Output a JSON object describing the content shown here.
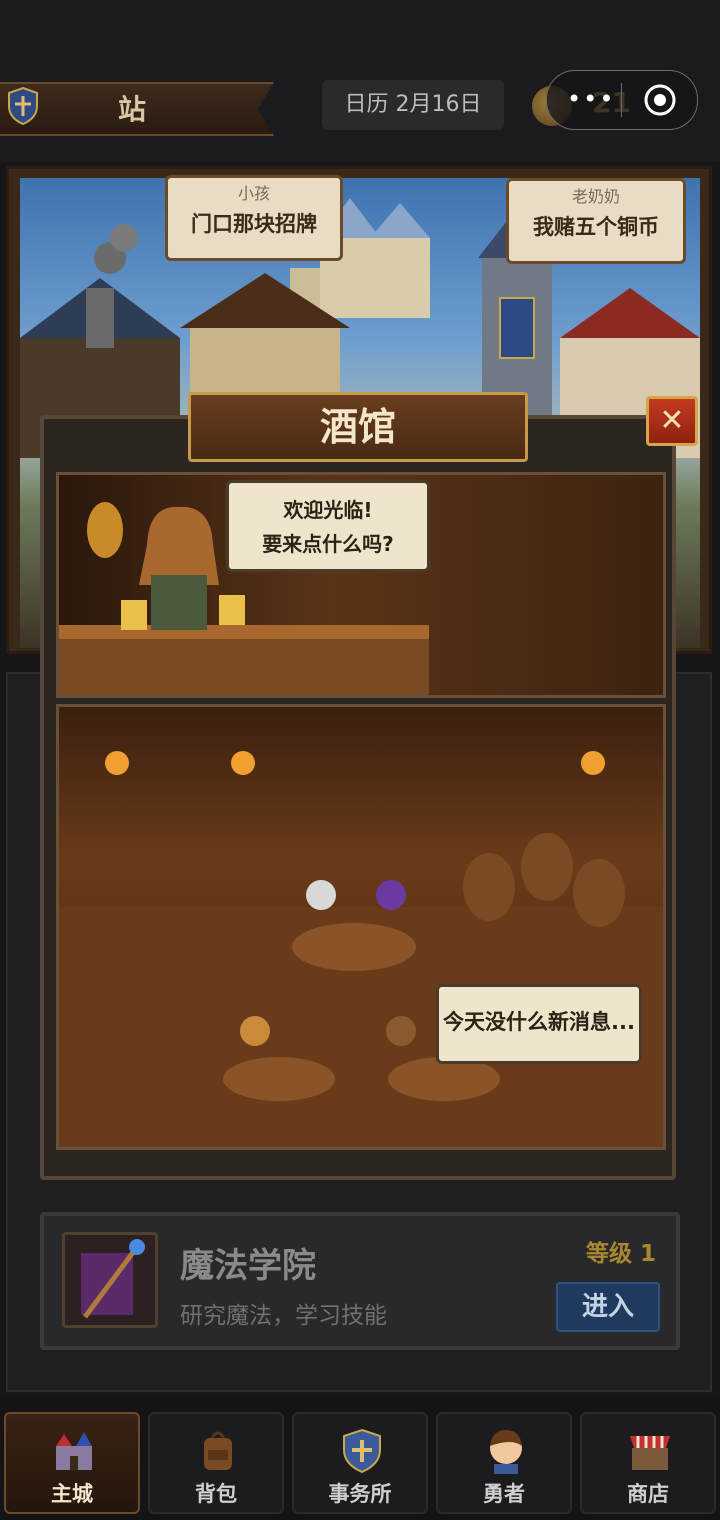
{
  "header": {
    "location": "站",
    "calendar": "日历 2月16日",
    "coins": "21"
  },
  "miniprogram_capsule": {
    "more": "•••"
  },
  "town": {
    "bubbles": [
      {
        "speaker": "小孩",
        "text": "门口那块招牌"
      },
      {
        "speaker": "老奶奶",
        "text": "我赌五个铜币"
      }
    ]
  },
  "tavern": {
    "title": "酒馆",
    "close_glyph": "✕",
    "barmaid_line1": "欢迎光临!",
    "barmaid_line2": "要来点什么吗?",
    "patron_speech": "今天没什么新消息..."
  },
  "academy": {
    "name": "魔法学院",
    "description": "研究魔法，学习技能",
    "level": "等级 1",
    "enter": "进入"
  },
  "nav": {
    "items": [
      {
        "label": "主城",
        "icon": "castle-icon",
        "active": true
      },
      {
        "label": "背包",
        "icon": "backpack-icon",
        "active": false
      },
      {
        "label": "事务所",
        "icon": "shield-icon",
        "active": false
      },
      {
        "label": "勇者",
        "icon": "hero-icon",
        "active": false
      },
      {
        "label": "商店",
        "icon": "shop-icon",
        "active": false
      }
    ]
  },
  "colors": {
    "wood": "#6a3d1f",
    "gold_border": "#c79a4a",
    "close_red": "#c43a1f",
    "enter_blue": "#1e3a5e",
    "coin_gold": "#c9a84a"
  }
}
